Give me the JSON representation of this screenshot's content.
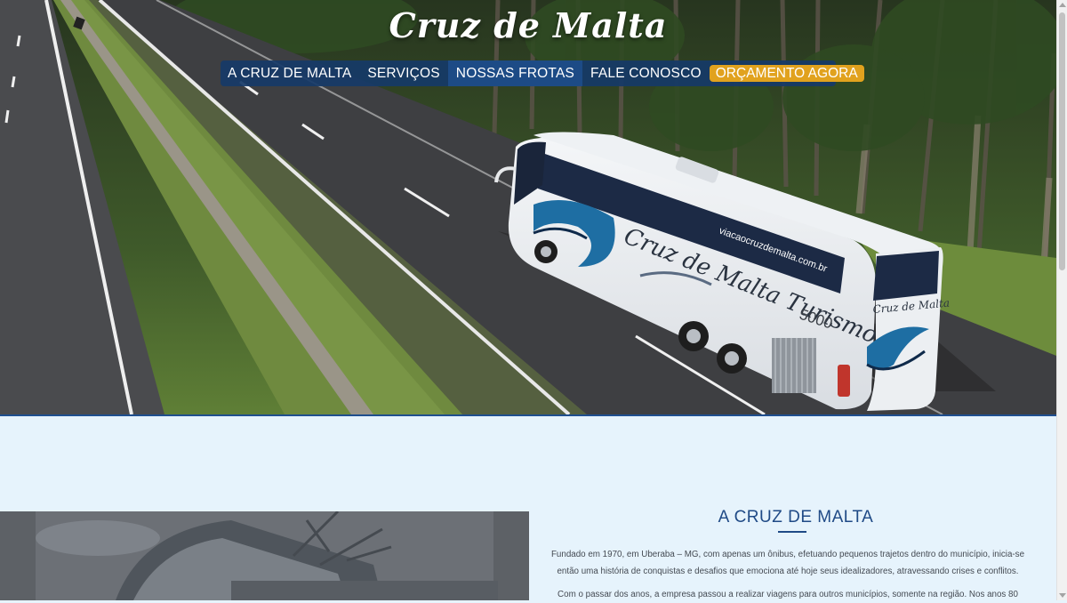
{
  "header": {
    "logo_text": "Cruz de Malta"
  },
  "nav": {
    "items": [
      {
        "label": "A CRUZ DE MALTA"
      },
      {
        "label": "SERVIÇOS"
      },
      {
        "label": "NOSSAS FROTAS"
      },
      {
        "label": "FALE CONOSCO"
      }
    ],
    "cta_label": "ORÇAMENTO AGORA"
  },
  "hero": {
    "bus_side_text": "Cruz de Malta Turismo",
    "bus_website": "viacaocruzdemalta.com.br",
    "bus_number": "5000",
    "bus_rear_text": "Cruz de Malta"
  },
  "about": {
    "title": "A CRUZ DE MALTA",
    "paragraph_1": "Fundado em 1970, em Uberaba – MG, com apenas um ônibus, efetuando pequenos trajetos dentro do município, inicia-se então uma história de conquistas e desafios que emociona até hoje seus idealizadores, atravessando crises e conflitos.",
    "paragraph_2": "Com o passar dos anos, a empresa passou a realizar viagens para outros municípios, somente na região. Nos anos 80"
  },
  "colors": {
    "brand_blue": "#1f4a86",
    "nav_bg": "#163a68",
    "cta_orange": "#e1a21e",
    "section_bg": "#e6f3fc"
  }
}
